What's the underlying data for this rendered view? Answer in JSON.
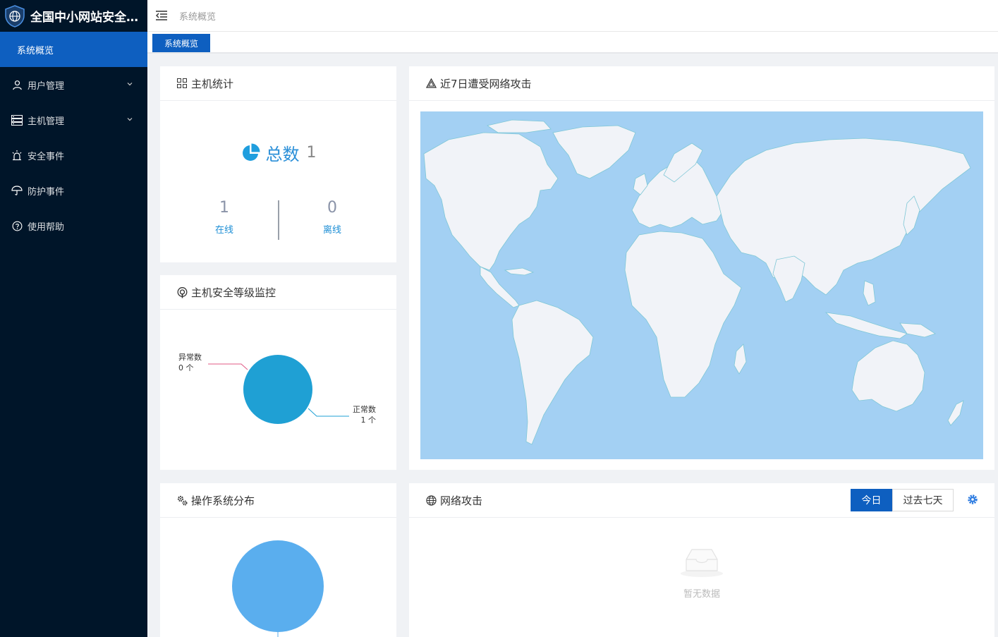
{
  "app": {
    "title": "全国中小网站安全防..."
  },
  "sidebar": {
    "active": "系统概览",
    "items": [
      {
        "label": "用户管理",
        "icon": "user-icon",
        "has_arrow": true
      },
      {
        "label": "主机管理",
        "icon": "server-icon",
        "has_arrow": true
      },
      {
        "label": "安全事件",
        "icon": "alarm-icon",
        "has_arrow": false
      },
      {
        "label": "防护事件",
        "icon": "umbrella-icon",
        "has_arrow": false
      },
      {
        "label": "使用帮助",
        "icon": "help-icon",
        "has_arrow": false
      }
    ]
  },
  "header": {
    "breadcrumb": "系统概览"
  },
  "tabs": [
    {
      "label": "系统概览"
    }
  ],
  "host_stats": {
    "title": "主机统计",
    "total_label": "总数",
    "total_value": "1",
    "online_value": "1",
    "online_label": "在线",
    "offline_value": "0",
    "offline_label": "离线"
  },
  "attack_map": {
    "title": "近7日遭受网络攻击"
  },
  "security_level": {
    "title": "主机安全等级监控",
    "abnormal_label": "异常数",
    "abnormal_value": "0 个",
    "normal_label": "正常数",
    "normal_value": "1 个"
  },
  "os_dist": {
    "title": "操作系统分布"
  },
  "network_attack": {
    "title": "网络攻击",
    "btn_today": "今日",
    "btn_week": "过去七天",
    "empty_text": "暂无数据"
  },
  "colors": {
    "sidebar_bg": "#001529",
    "accent": "#0e5fc0",
    "pie_security": "#1fa0d4",
    "pie_os": "#5aaeee",
    "map_ocean": "#a3d0f3",
    "map_land": "#f1f3f8"
  }
}
